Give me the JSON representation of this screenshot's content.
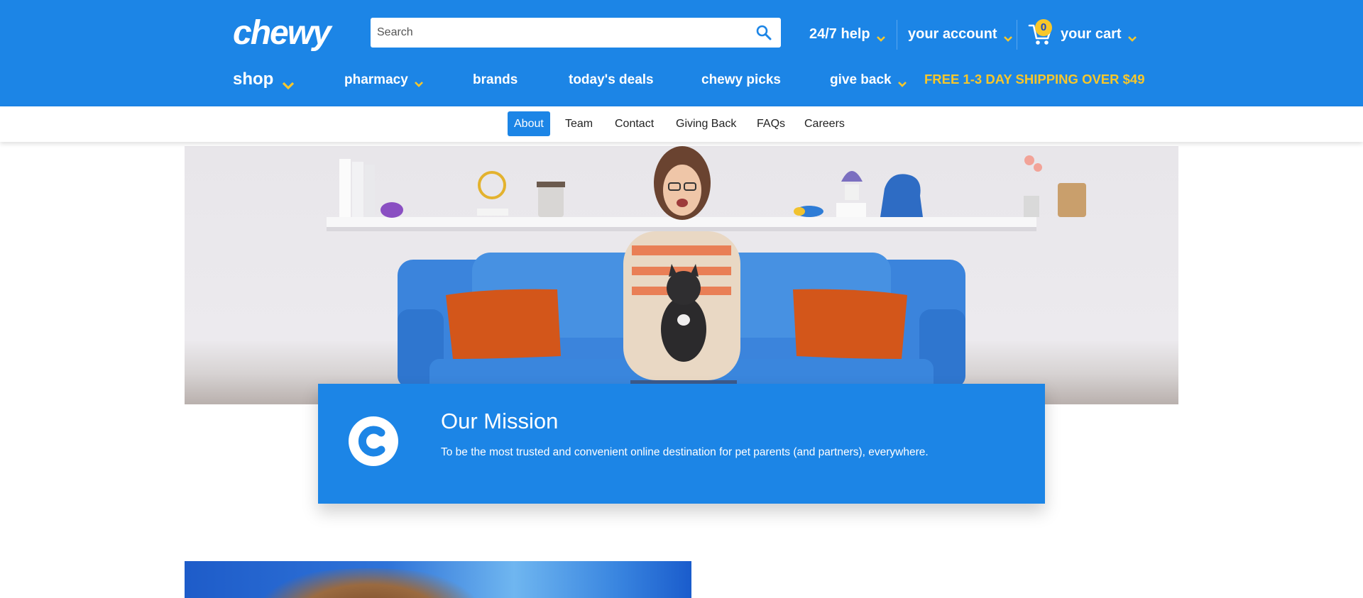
{
  "header": {
    "logo": "chewy",
    "search": {
      "placeholder": "Search",
      "value": ""
    },
    "help_label": "24/7 help",
    "account_label": "your account",
    "cart": {
      "label": "your cart",
      "count": "0"
    },
    "nav": [
      {
        "label": "shop"
      },
      {
        "label": "pharmacy"
      },
      {
        "label": "brands"
      },
      {
        "label": "today's deals"
      },
      {
        "label": "chewy picks"
      },
      {
        "label": "give back"
      }
    ],
    "promo": "FREE 1-3 DAY SHIPPING OVER $49"
  },
  "subnav": {
    "items": [
      "About",
      "Team",
      "Contact",
      "Giving Back",
      "FAQs",
      "Careers"
    ],
    "active": "About"
  },
  "mission": {
    "title": "Our Mission",
    "text": "To be the most trusted and convenient online destination for pet parents (and partners), everywhere."
  },
  "colors": {
    "brand_blue": "#1c85e6",
    "accent_yellow": "#f8c72a",
    "white": "#ffffff"
  },
  "icons": [
    "search-icon",
    "chevron-down-icon",
    "cart-icon",
    "chewy-c-logo-icon"
  ]
}
